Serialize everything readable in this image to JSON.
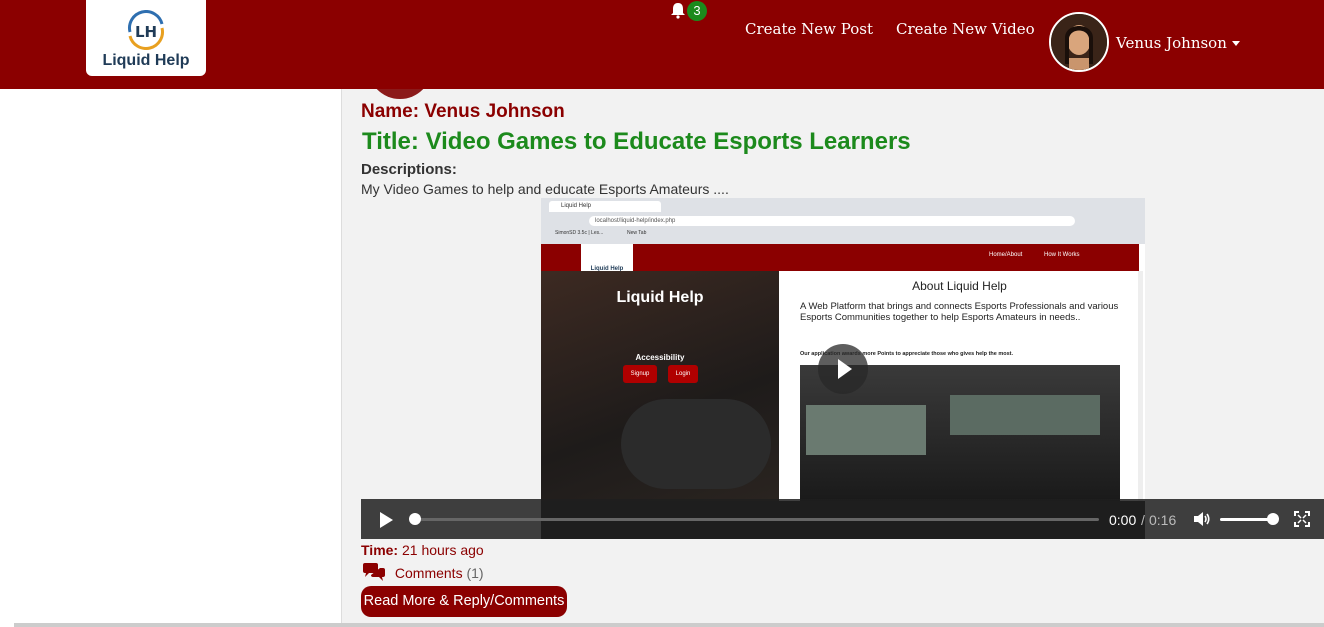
{
  "navbar": {
    "logo_text": "Liquid Help",
    "logo_monogram": "LH",
    "notification_count": "3",
    "links": [
      "Create New Post",
      "Create New Video"
    ],
    "user_name": "Venus Johnson"
  },
  "post": {
    "name_label": "Name: Venus Johnson",
    "title": "Title: Video Games to Educate Esports Learners",
    "descriptions_label": "Descriptions:",
    "description": "My Video Games to help and educate Esports Amateurs ....",
    "time_label": "Time:",
    "time_value": "21 hours ago",
    "comments_label": "Comments",
    "comments_count": "(1)",
    "read_more_label": "Read More & Reply/Comments"
  },
  "video": {
    "current_time": "0:00",
    "separator": "/",
    "duration": "0:16",
    "progress": 0,
    "volume": 0.9,
    "frame": {
      "tab_title": "Liquid Help",
      "url": "localhost/liquid-help/index.php",
      "bookmark_1": "SimonSD 3.5c | Les...",
      "bookmark_2": "New Tab",
      "logo_text": "Liquid Help",
      "nav_1": "Home/About",
      "nav_2": "How It Works",
      "hero_title": "Liquid Help",
      "accessibility": "Accessibility",
      "signup": "Signup",
      "login": "Login",
      "about_title": "About Liquid Help",
      "about_text": "A Web Platform that brings and connects Esports Professionals and various Esports Communities together to help Esports Amateurs in needs..",
      "points_text": "Our application awards more Points to appreciate those who gives help the most."
    }
  },
  "colors": {
    "brand": "#8b0000",
    "title_green": "#1c8a1c"
  }
}
